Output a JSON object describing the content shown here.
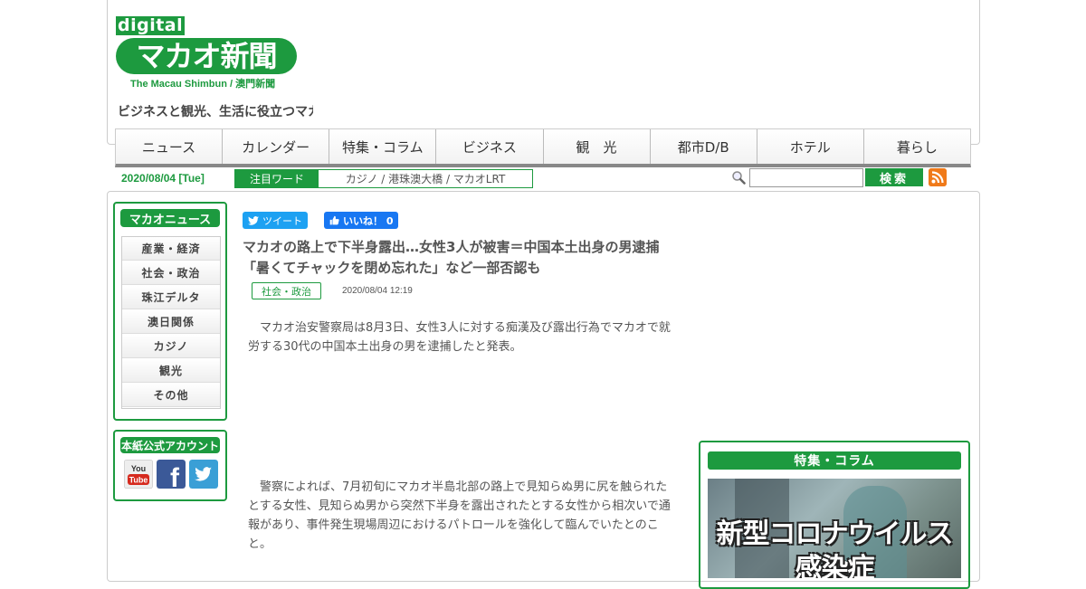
{
  "header": {
    "logo_digital": "digital",
    "logo_main": "マカオ新聞",
    "logo_sub": "The Macau Shimbun / 澳門新聞",
    "tagline": "ビジネスと観光、生活に役立つマカ"
  },
  "nav": {
    "items": [
      "ニュース",
      "カレンダー",
      "特集・コラム",
      "ビジネス",
      "観　光",
      "都市D/B",
      "ホテル",
      "暮らし"
    ]
  },
  "subbar": {
    "date": "2020/08/04 [Tue]",
    "trend_label": "注目ワード",
    "trend_words": "カジノ / 港珠澳大橋 / マカオLRT",
    "search_value": "",
    "search_button": "検索"
  },
  "sidebar": {
    "news_heading": "マカオニュース",
    "news_items": [
      "産業・経済",
      "社会・政治",
      "珠江デルタ",
      "澳日関係",
      "カジノ",
      "観光",
      "その他"
    ],
    "account_heading": "本紙公式アカウント"
  },
  "article": {
    "tweet_label": "ツイート",
    "like_label": "いいね！ 0",
    "title_line1": "マカオの路上で下半身露出…女性3人が被害＝中国本土出身の男逮捕",
    "title_line2": "「暑くてチャックを閉め忘れた」など一部否認も",
    "category": "社会・政治",
    "date": "2020/08/04 12:19",
    "paragraph1": "マカオ治安警察局は8月3日、女性3人に対する痴漢及び露出行為でマカオで就労する30代の中国本土出身の男を逮捕したと発表。",
    "paragraph2": "警察によれば、7月初旬にマカオ半島北部の路上で見知らぬ男に尻を触られたとする女性、見知らぬ男から突然下半身を露出されたとする女性から相次いで通報があり、事件発生現場周辺におけるパトロールを強化して臨んでいたとのこと。"
  },
  "feature": {
    "heading": "特集・コラム",
    "image_line1": "新型コロナウイルス",
    "image_line2": "感染症"
  },
  "colors": {
    "brand_green": "#1d9a3f",
    "twitter_blue": "#1da1f2",
    "facebook_blue": "#1877f2",
    "rss_orange": "#f07a1a"
  },
  "icons": [
    "search-icon",
    "rss-icon",
    "twitter-icon",
    "facebook-like-icon",
    "youtube-icon",
    "facebook-icon",
    "twitter-bird-icon"
  ]
}
